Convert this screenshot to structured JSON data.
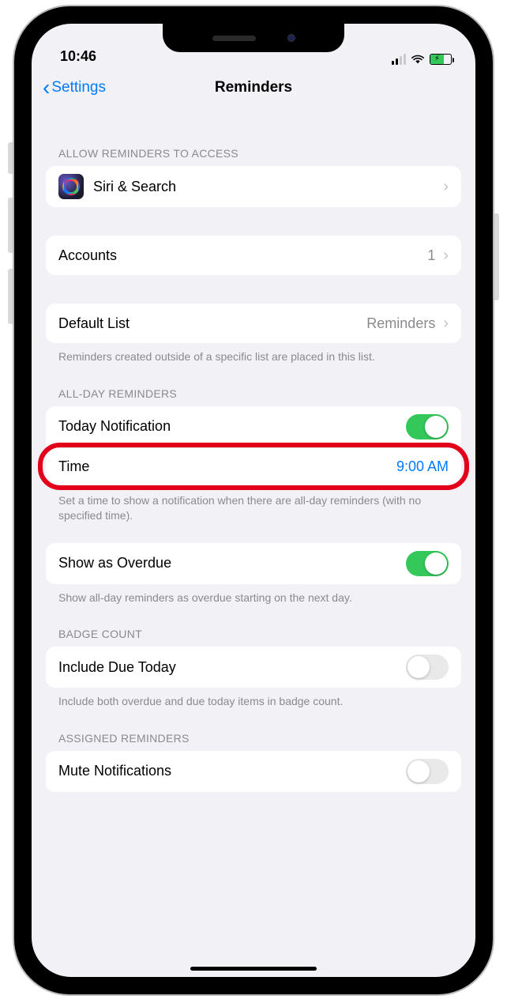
{
  "status": {
    "time": "10:46"
  },
  "nav": {
    "back_label": "Settings",
    "title": "Reminders"
  },
  "sections": {
    "allow_access_header": "ALLOW REMINDERS TO ACCESS",
    "siri_label": "Siri & Search",
    "accounts_label": "Accounts",
    "accounts_value": "1",
    "default_list_label": "Default List",
    "default_list_value": "Reminders",
    "default_list_footer": "Reminders created outside of a specific list are placed in this list.",
    "allday_header": "ALL-DAY REMINDERS",
    "today_notif_label": "Today Notification",
    "time_label": "Time",
    "time_value": "9:00 AM",
    "allday_footer": "Set a time to show a notification when there are all-day reminders (with no specified time).",
    "show_overdue_label": "Show as Overdue",
    "show_overdue_footer": "Show all-day reminders as overdue starting on the next day.",
    "badge_header": "BADGE COUNT",
    "include_due_label": "Include Due Today",
    "include_due_footer": "Include both overdue and due today items in badge count.",
    "assigned_header": "ASSIGNED REMINDERS",
    "mute_label": "Mute Notifications"
  },
  "toggles": {
    "today_notif": true,
    "show_overdue": true,
    "include_due": false,
    "mute": false
  }
}
